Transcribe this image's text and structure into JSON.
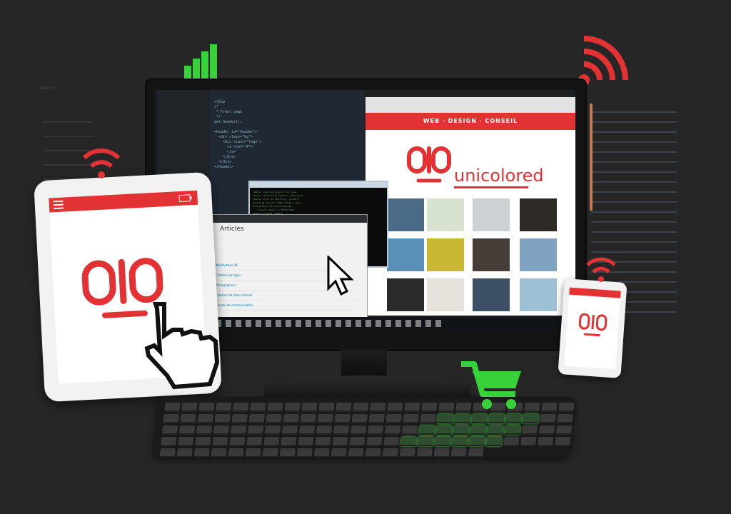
{
  "site": {
    "nav_text": "WEB · DESIGN · CONSEIL",
    "brand": "unicolored"
  },
  "admin": {
    "title": "Articles",
    "rows": [
      "Modification 2K",
      "Création de logos",
      "Photographies",
      "Création de sites internet",
      "Goyaté de communication"
    ]
  },
  "colors": {
    "brand_red": "#e23234",
    "signal_green": "#38d13a",
    "background": "#262626"
  },
  "icons": [
    "wifi-icon",
    "signal-bars-icon",
    "shopping-cart-icon",
    "pointer-hand-icon",
    "arrow-cursor-icon",
    "menu-icon",
    "battery-icon"
  ]
}
